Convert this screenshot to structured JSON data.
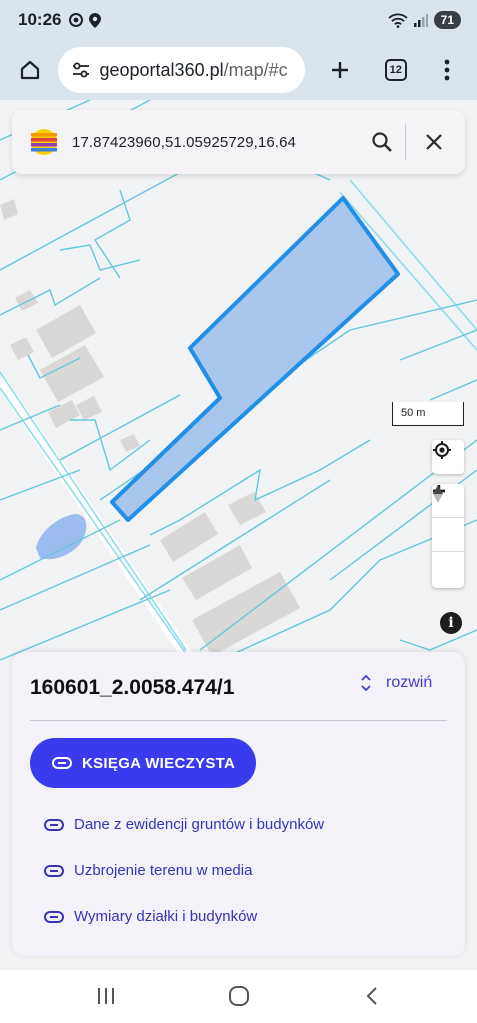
{
  "status_bar": {
    "time": "10:26",
    "battery": "71"
  },
  "browser": {
    "url_host": "geoportal360.pl",
    "url_path": "/map/#c",
    "tab_count": "12"
  },
  "search": {
    "value": "17.87423960,51.05925729,16.64"
  },
  "map": {
    "scale_label": "50 m",
    "parcel_fill": "#a9c6ec",
    "parcel_stroke": "#1f8fe8",
    "boundary_color": "#67c7dc"
  },
  "panel": {
    "parcel_id": "160601_2.0058.474/1",
    "expand_label": "rozwiń",
    "primary_button": "KSIĘGA WIECZYSTA",
    "links": [
      "Dane z ewidencji gruntów i budynków",
      "Uzbrojenie terenu w media",
      "Wymiary działki i budynków"
    ]
  },
  "colors": {
    "accent": "#3a3aee",
    "link": "#3535b8"
  }
}
